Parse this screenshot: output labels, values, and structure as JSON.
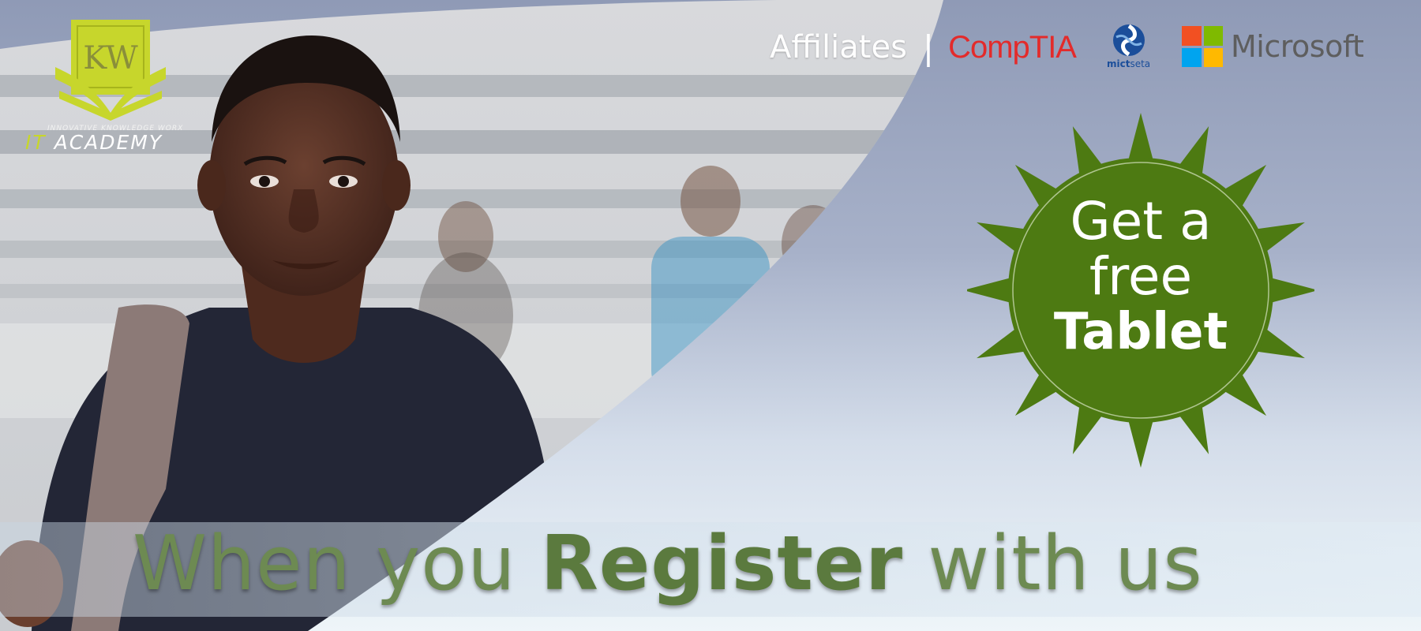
{
  "logo": {
    "monogram": "KW",
    "tagline": "INNOVATIVE KNOWLEDGE WORX",
    "name_prefix": "IT",
    "name_rest": " ACADEMY"
  },
  "affiliates": {
    "label": "Affiliates",
    "separator": "|",
    "comptia": "CompTIA",
    "mict_bold": "mict",
    "mict_rest": "seta",
    "microsoft": "Microsoft"
  },
  "badge": {
    "line1": "Get a",
    "line2": "free",
    "line3": "Tablet",
    "color": "#4d7a12"
  },
  "headline": {
    "part1": "When you ",
    "emphasis": "Register",
    "part2": " with us"
  },
  "colors": {
    "logo_yellow": "#c7d62c",
    "comptia_red": "#e32b2b",
    "headline_green": "#6d8a52",
    "ms_red": "#f25022",
    "ms_green": "#7fba00",
    "ms_blue": "#00a4ef",
    "ms_yellow": "#ffb900"
  }
}
